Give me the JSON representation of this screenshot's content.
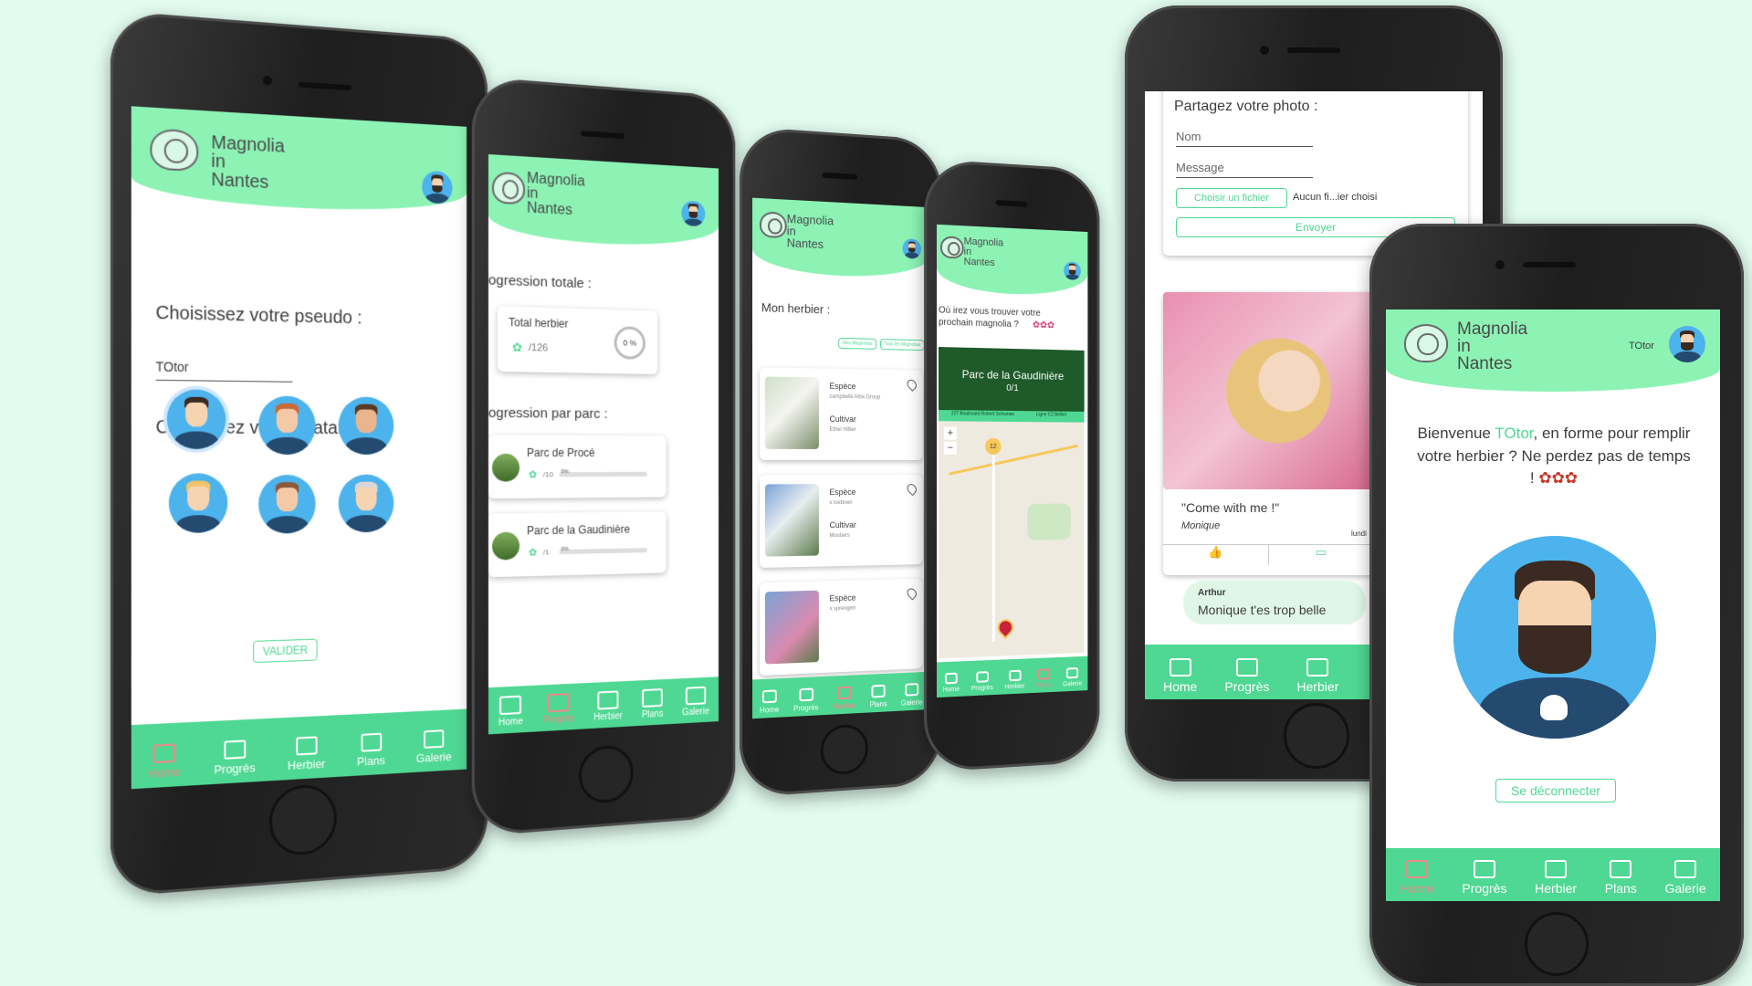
{
  "app": {
    "name_line1": "Magnolia",
    "name_line2": "in",
    "name_line3": "Nantes"
  },
  "nav": {
    "home": "Home",
    "progress": "Progrès",
    "herbier": "Herbier",
    "plans": "Plans",
    "galerie": "Galerie"
  },
  "screen1": {
    "pseudo_label": "Choisissez votre pseudo :",
    "pseudo_value": "TOtor",
    "avatar_label": "Choisissez votre avatar :",
    "validate": "VALIDER",
    "avatars": [
      {
        "bg": "#4db3ec",
        "skin": "#f6d3b1",
        "hair": "#3a2a22"
      },
      {
        "bg": "#4db3ec",
        "skin": "#f3c9a6",
        "hair": "#c86a3a"
      },
      {
        "bg": "#4db3ec",
        "skin": "#e9b48e",
        "hair": "#5a3a22"
      },
      {
        "bg": "#4db3ec",
        "skin": "#f6d3b1",
        "hair": "#f0c46a"
      },
      {
        "bg": "#4db3ec",
        "skin": "#f3c9a6",
        "hair": "#8a5a3a"
      },
      {
        "bg": "#4db3ec",
        "skin": "#f6d3b1",
        "hair": "#d7d7d7"
      }
    ]
  },
  "screen2": {
    "progress_total": "ogression totale :",
    "total_herbier": "Total herbier",
    "total_count": "/126",
    "total_pct": "0 %",
    "progress_park": "ogression par parc :",
    "parks": [
      {
        "name": "Parc de Procé",
        "count": "/10",
        "pct": "0%"
      },
      {
        "name": "Parc de la Gaudinière",
        "count": "/1",
        "pct": "0%"
      }
    ]
  },
  "screen3": {
    "title": "Mon herbier :",
    "filter1": "Mes Magnolias",
    "filter2": "Tous les Magnolias",
    "cards": [
      {
        "espece_label": "Espèce",
        "espece": "campbellii Alba Group",
        "cultivar_label": "Cultivar",
        "cultivar": "Ethel Hillier"
      },
      {
        "espece_label": "Espèce",
        "espece": "x loebneri",
        "cultivar_label": "Cultivar",
        "cultivar": "Moutiers"
      },
      {
        "espece_label": "Espèce",
        "espece": "x sprengeri",
        "cultivar_label": "",
        "cultivar": ""
      }
    ]
  },
  "screen4": {
    "question": "Où irez vous trouver votre prochain magnolia ?",
    "park_title": "Parc de la Gaudinière",
    "park_sub": "0/1",
    "address": "227 Boulevard Robert Schuman",
    "bus": "Ligne C2 Bellier",
    "zoom_in": "+",
    "zoom_out": "−",
    "cluster": "12"
  },
  "screen5": {
    "share_title": "Partagez votre photo :",
    "name_label": "Nom",
    "message_label": "Message",
    "choose_file": "Choisir un fichier",
    "no_file": "Aucun fi...ier choisi",
    "send": "Envoyer",
    "quote": "\"Come with me !\"",
    "author": "Monique",
    "date": "lundi",
    "comment_author": "Arthur",
    "comment_text": "Monique t'es trop belle"
  },
  "screen6": {
    "pseudo": "TOtor",
    "welcome_prefix": "Bienvenue ",
    "welcome_name": "TOtor",
    "welcome_suffix": ", en forme pour remplir votre herbier ? Ne perdez pas de temps !",
    "logout": "Se déconnecter"
  },
  "colors": {
    "accent": "#4fd893",
    "header": "#8cf3b5",
    "background": "#e2fbef",
    "active_nav": "#f08a8a"
  }
}
